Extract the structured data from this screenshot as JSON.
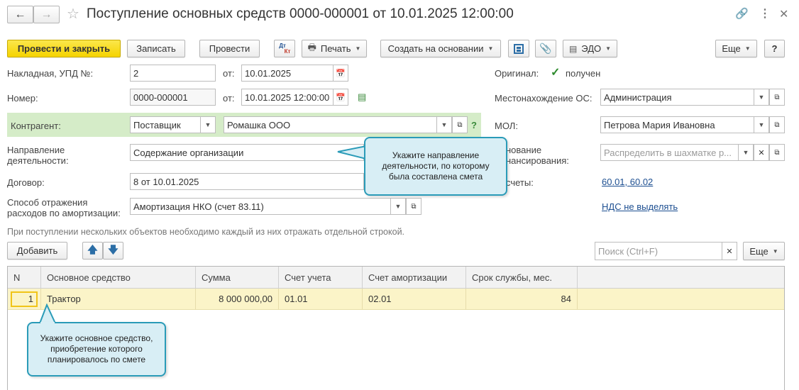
{
  "window": {
    "title": "Поступление основных средств 0000-000001 от 10.01.2025 12:00:00"
  },
  "toolbar": {
    "post_close": "Провести и закрыть",
    "save": "Записать",
    "post": "Провести",
    "dtkt_top": "Дт",
    "dtkt_bottom": "Кт",
    "print": "Печать",
    "create_based": "Создать на основании",
    "edo": "ЭДО",
    "more": "Еще",
    "help": "?"
  },
  "form": {
    "invoice_label": "Накладная, УПД №:",
    "invoice_value": "2",
    "from_label": "от:",
    "invoice_date": "10.01.2025",
    "number_label": "Номер:",
    "number_value": "0000-000001",
    "doc_datetime": "10.01.2025 12:00:00",
    "counterparty_label": "Контрагент:",
    "counterparty_type": "Поставщик",
    "counterparty_value": "Ромашка ООО",
    "question": "?",
    "direction_label_1": "Направление",
    "direction_label_2": "деятельности:",
    "direction_value": "Содержание организации",
    "contract_label": "Договор:",
    "contract_value": "8 от 10.01.2025",
    "amort_label_1": "Способ отражения",
    "amort_label_2": "расходов по амортизации:",
    "amort_value": "Амортизация НКО (счет 83.11)",
    "original_label": "Оригинал:",
    "original_value": "получен",
    "location_label": "Местонахождение ОС:",
    "location_value": "Администрация",
    "mol_label": "МОЛ:",
    "mol_value": "Петрова Мария Ивановна",
    "funding_label_1": "нование",
    "funding_label_2": "нансирования:",
    "funding_placeholder": "Распределить в шахматке р...",
    "accounts_label": "счеты:",
    "accounts_link": "60.01, 60.02",
    "vat_link": "НДС не выделять",
    "hint": "При поступлении нескольких объектов необходимо каждый из них отражать отдельной строкой."
  },
  "table_toolbar": {
    "add": "Добавить",
    "search_placeholder": "Поиск (Ctrl+F)",
    "more": "Еще"
  },
  "table": {
    "headers": [
      "N",
      "Основное средство",
      "Сумма",
      "Счет учета",
      "Счет амортизации",
      "Срок службы, мес."
    ],
    "rows": [
      [
        "1",
        "Трактор",
        "8 000 000,00",
        "01.01",
        "02.01",
        "84"
      ]
    ]
  },
  "callouts": {
    "direction": "Укажите направление деятельности, по которому была составлена смета",
    "asset": "Укажите основное средство, приобретение которого планировалось по смете"
  },
  "colors": {
    "primary_button": "#f5d300",
    "counterparty_band": "#d5ecc8",
    "selected_row": "#fbf4c8",
    "link": "#1d4f91",
    "callout_border": "#2a9bb8",
    "callout_fill": "#d8eef5"
  }
}
